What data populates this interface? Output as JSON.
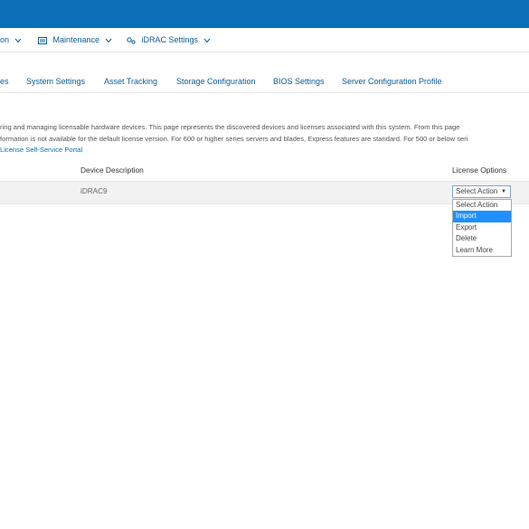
{
  "colors": {
    "brand_bar": "#0a6fb6",
    "link": "#0a5c98",
    "highlight": "#1e90ff"
  },
  "menu": {
    "items": [
      {
        "label": "on",
        "icon": "chevron-down-icon"
      },
      {
        "label": "Maintenance",
        "icon": "maintenance-icon"
      },
      {
        "label": "iDRAC Settings",
        "icon": "idrac-settings-icon"
      }
    ]
  },
  "tabs": [
    {
      "label": "es",
      "active": true
    },
    {
      "label": "System Settings"
    },
    {
      "label": "Asset Tracking"
    },
    {
      "label": "Storage Configuration"
    },
    {
      "label": "BIOS Settings"
    },
    {
      "label": "Server Configuration Profile"
    }
  ],
  "description": {
    "line1": "ring and managing licensable hardware devices. This page represents the discovered devices and licenses associated with this system. From this page",
    "line2": "formation is not available for the default license version. For 600 or higher series servers and blades, Express features are standard. For 500 or below seri",
    "link": "License Self-Service Portal"
  },
  "table": {
    "headers": {
      "device_description": "Device Description",
      "license_options": "License Options"
    },
    "rows": [
      {
        "device_description": "iDRAC9",
        "license_option_selected": "Select Action"
      }
    ]
  },
  "license_dropdown": {
    "selected": "Select Action",
    "highlighted": "Import",
    "options": [
      "Select Action",
      "Import",
      "Export",
      "Delete",
      "Learn More"
    ]
  }
}
